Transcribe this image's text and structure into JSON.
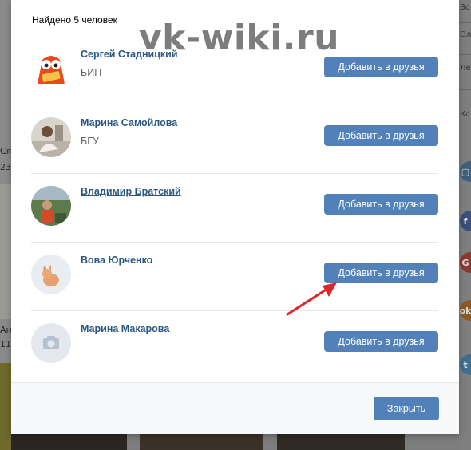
{
  "background": {
    "left_texts": [
      "Ся",
      "23",
      "Ан",
      "11"
    ],
    "right_texts": [
      "Вс",
      "Ол",
      "Ле",
      "Кс"
    ],
    "social_icons": [
      {
        "icon": "monitor-icon",
        "glyph": "▢",
        "color": "#3d5f7c"
      },
      {
        "icon": "facebook-icon",
        "glyph": "f",
        "color": "#3b4f78"
      },
      {
        "icon": "google-plus-icon",
        "glyph": "G",
        "color": "#8a3a2c"
      },
      {
        "icon": "odnoklassniki-icon",
        "glyph": "ok",
        "color": "#8a5a20"
      },
      {
        "icon": "twitter-icon",
        "glyph": "t",
        "color": "#3f6f8f"
      }
    ]
  },
  "modal": {
    "count_text": "Найдено 5 человек",
    "watermark": "vk-wiki.ru",
    "people": [
      {
        "name": "Сергей Стадницкий",
        "subtitle": "БИП",
        "button": "Добавить в друзья",
        "avatar": "orange-cartoon"
      },
      {
        "name": "Марина Самойлова",
        "subtitle": "БГУ",
        "button": "Добавить в друзья",
        "avatar": "photo-light"
      },
      {
        "name": "Владимир Братский",
        "subtitle": "",
        "button": "Добавить в друзья",
        "avatar": "photo-outdoor"
      },
      {
        "name": "Вова Юрченко",
        "subtitle": "",
        "button": "Добавить в друзья",
        "avatar": "photo-cat"
      },
      {
        "name": "Марина Макарова",
        "subtitle": "",
        "button": "Добавить в друзья",
        "avatar": "camera-placeholder"
      }
    ],
    "close_button": "Закрыть"
  },
  "colors": {
    "accent": "#5181b8",
    "link": "#2a5885",
    "arrow": "#e0242b"
  }
}
